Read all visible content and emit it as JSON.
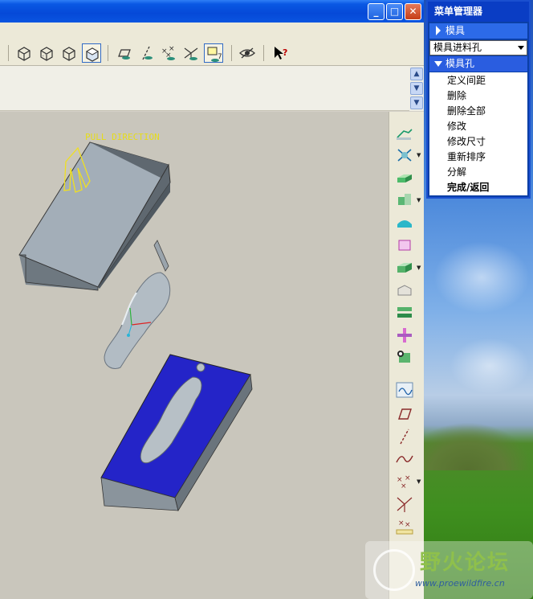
{
  "window": {
    "min_glyph": "_",
    "max_glyph": "□",
    "close_glyph": "✕"
  },
  "model": {
    "pull_direction_label": "PULL DIRECTION"
  },
  "menu_manager": {
    "title": "菜单管理器",
    "mold_item": "模具",
    "select_value": "模具进料孔",
    "sub_header": "模具孔",
    "items": [
      "定义间距",
      "删除",
      "删除全部",
      "修改",
      "修改尺寸",
      "重新排序",
      "分解",
      "完成/返回"
    ]
  },
  "watermark": {
    "title": "野火论坛",
    "url": "www.proewildfire.cn"
  },
  "colors": {
    "titlebar": "#0549d8",
    "menu_bg": "#0b3fa6",
    "cavity_blue": "#2222cc",
    "part_grey": "#a9b4bd",
    "pull_arrow_yellow": "#f0e020"
  }
}
